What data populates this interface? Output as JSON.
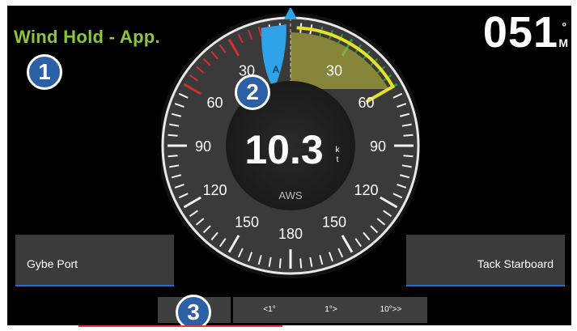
{
  "mode": {
    "title": "Wind Hold - App."
  },
  "heading": {
    "value": "051",
    "unit_deg": "°",
    "unit_ref": "M"
  },
  "gauge": {
    "speed": "10.3",
    "speed_unit_top": "k",
    "speed_unit_bottom": "t",
    "speed_label": "AWS",
    "wind_marker": "A",
    "port_scale_labels": [
      "30",
      "60",
      "90",
      "120",
      "150"
    ],
    "starboard_scale_labels": [
      "30",
      "60",
      "90",
      "120",
      "150"
    ],
    "stern_label": "180",
    "colors": {
      "port": "#d32f2f",
      "starboard": "#2e9e3e",
      "hold_arc": "#e6e02a",
      "wind": "#2ea3e8"
    }
  },
  "buttons": {
    "gybe_port": "Gybe Port",
    "tack_starboard": "Tack Starboard",
    "port_10": "",
    "port_1": "<1°",
    "stbd_1": "1°>",
    "stbd_10": "10°>>"
  },
  "callouts": [
    "1",
    "2",
    "3"
  ]
}
